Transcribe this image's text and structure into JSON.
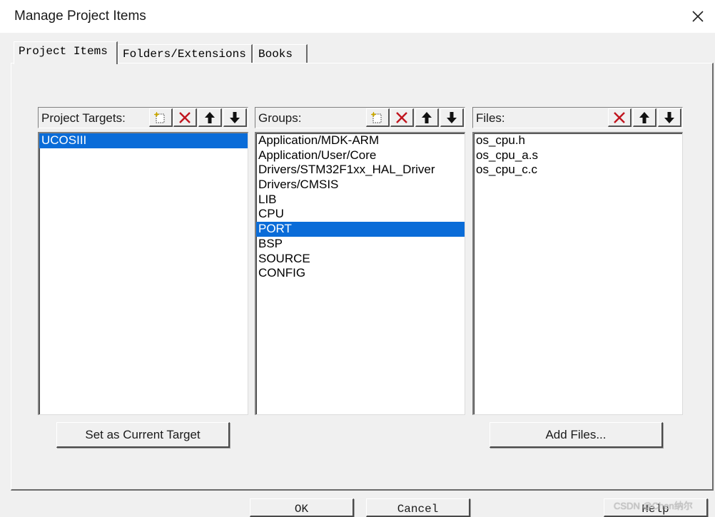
{
  "window": {
    "title": "Manage Project Items"
  },
  "tabs": [
    {
      "label": "Project Items",
      "active": true
    },
    {
      "label": "Folders/Extensions",
      "active": false
    },
    {
      "label": "Books",
      "active": false
    }
  ],
  "targets_panel": {
    "label": "Project Targets:",
    "items": [
      {
        "text": "UCOSIII",
        "selected": true
      }
    ],
    "button": "Set as Current Target"
  },
  "groups_panel": {
    "label": "Groups:",
    "items": [
      {
        "text": "Application/MDK-ARM",
        "selected": false
      },
      {
        "text": "Application/User/Core",
        "selected": false
      },
      {
        "text": "Drivers/STM32F1xx_HAL_Driver",
        "selected": false
      },
      {
        "text": "Drivers/CMSIS",
        "selected": false
      },
      {
        "text": "LIB",
        "selected": false
      },
      {
        "text": "CPU",
        "selected": false
      },
      {
        "text": "PORT",
        "selected": true
      },
      {
        "text": "BSP",
        "selected": false
      },
      {
        "text": "SOURCE",
        "selected": false
      },
      {
        "text": "CONFIG",
        "selected": false
      }
    ]
  },
  "files_panel": {
    "label": "Files:",
    "items": [
      {
        "text": "os_cpu.h",
        "selected": false
      },
      {
        "text": "os_cpu_a.s",
        "selected": false
      },
      {
        "text": "os_cpu_c.c",
        "selected": false
      }
    ],
    "button": "Add Files..."
  },
  "footer": {
    "ok": "OK",
    "cancel": "Cancel",
    "help": "Help"
  },
  "watermark": "CSDN @Chen纳尔",
  "colors": {
    "selection": "#0a6cd8",
    "delete_icon": "#c0141e",
    "window_bg": "#f0f0f0"
  }
}
